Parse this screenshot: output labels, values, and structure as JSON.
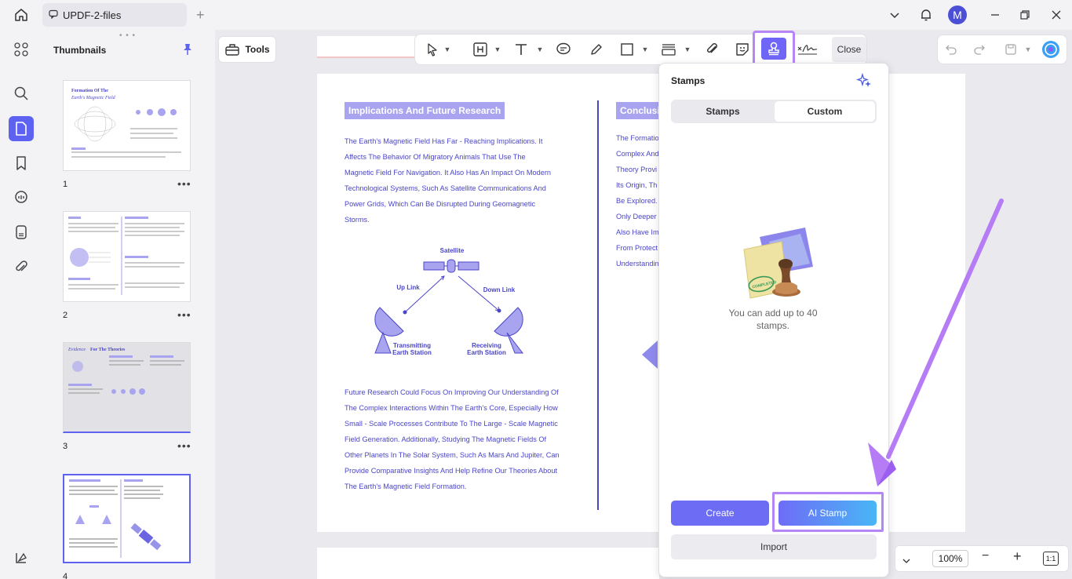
{
  "titlebar": {
    "tab_label": "UPDF-2-files",
    "add_tab": "+",
    "avatar_letter": "M"
  },
  "thumbnails": {
    "title": "Thumbnails",
    "drag_handle": "• • •",
    "pages": [
      {
        "number": "1",
        "more": "•••",
        "heading_a": "Formation Of The",
        "heading_b": "Earth's Magnetic Field"
      },
      {
        "number": "2",
        "more": "•••"
      },
      {
        "number": "3",
        "more": "•••",
        "heading_a": "Evidence",
        "heading_b": "For The Theories"
      },
      {
        "number": "4",
        "more": "•••"
      }
    ]
  },
  "tools_button": {
    "label": "Tools"
  },
  "toolbar": {
    "close_label": "Close"
  },
  "document": {
    "left_title": "Implications And Future Research",
    "left_para1": [
      "The Earth's Magnetic Field Has Far - Reaching Implications. It",
      "Affects The Behavior Of Migratory Animals That Use The",
      "Magnetic Field For Navigation. It Also Has An Impact On Modern",
      "Technological Systems, Such As Satellite Communications And",
      "Power Grids, Which Can Be Disrupted During Geomagnetic",
      "Storms."
    ],
    "diagram": {
      "satellite": "Satellite",
      "up_link": "Up Link",
      "down_link": "Down Link",
      "transmitting_a": "Transmitting",
      "transmitting_b": "Earth Station",
      "receiving_a": "Receiving",
      "receiving_b": "Earth Station"
    },
    "left_para2": [
      "Future Research Could Focus On Improving Our Understanding Of",
      "The Complex Interactions Within The Earth's Core, Especially How",
      "Small - Scale Processes Contribute To The Large - Scale Magnetic",
      "Field Generation. Additionally, Studying The Magnetic Fields Of",
      "Other Planets In The Solar System, Such As Mars And Jupiter, Can",
      "Provide Comparative Insights And Help Refine Our Theories About",
      "The Earth's Magnetic Field Formation."
    ],
    "right_title": "Conclusi",
    "right_lines": [
      "The Formatio",
      "Complex And",
      "Theory Provi",
      "Its Origin, Th",
      "Be Explored.",
      "Only Deeper",
      "Also Have Im",
      "From Protect",
      "Understandin"
    ]
  },
  "stamps_panel": {
    "title": "Stamps",
    "tab_stamps": "Stamps",
    "tab_custom": "Custom",
    "active_tab": "Custom",
    "empty_text": "You can add up to 40 stamps.",
    "stamp_label": "COMPLETED",
    "create_label": "Create",
    "ai_stamp_label": "AI Stamp",
    "import_label": "Import"
  },
  "zoom": {
    "value": "100%",
    "fit_label": "1:1",
    "minus": "−",
    "plus": "+"
  },
  "colors": {
    "accent": "#5d63f0",
    "highlight": "#b686f7",
    "doc_text": "#4a45c8",
    "doc_heading_bg": "#a9a4ef"
  }
}
